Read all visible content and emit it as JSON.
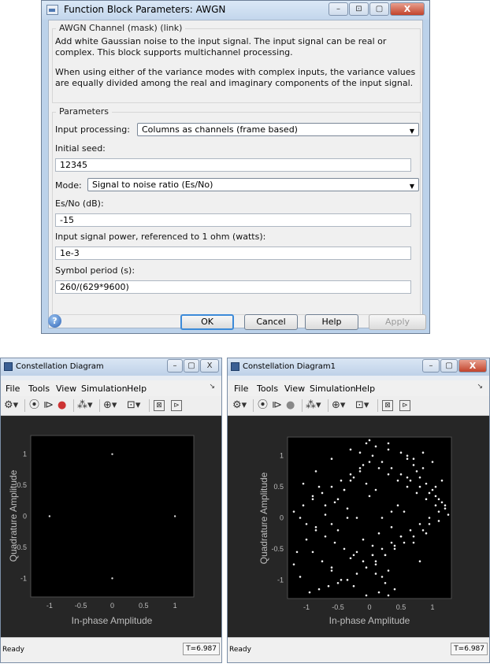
{
  "dialog": {
    "title": "Function Block Parameters: AWGN",
    "window_buttons": {
      "minimize": "–",
      "restore": "⊡",
      "maximize": "▢",
      "close": "X"
    },
    "mask_title": "AWGN Channel (mask) (link)",
    "description_1": "Add white Gaussian noise to the input signal. The input signal can be real or complex. This block supports multichannel processing.",
    "description_2": "When using either of the variance modes with complex inputs, the variance values are equally divided among the real and imaginary components of the input signal.",
    "parameters_title": "Parameters",
    "input_processing_label": "Input processing:",
    "input_processing_value": "Columns as channels (frame based)",
    "initial_seed_label": "Initial seed:",
    "initial_seed_value": "12345",
    "mode_label": "Mode:",
    "mode_value": "Signal to noise ratio  (Es/No)",
    "esno_label": "Es/No (dB):",
    "esno_value": "-15",
    "power_label": "Input signal power, referenced to 1 ohm (watts):",
    "power_value": "1e-3",
    "symbol_period_label": "Symbol period (s):",
    "symbol_period_value": "260/(629*9600)",
    "buttons": {
      "ok": "OK",
      "cancel": "Cancel",
      "help": "Help",
      "apply": "Apply"
    },
    "help_icon": "?"
  },
  "constellation_left": {
    "title": "Constellation Diagram",
    "menu": [
      "File",
      "Tools",
      "View",
      "Simulation",
      "Help"
    ],
    "status": "Ready",
    "time": "T=6.987",
    "ylabel": "Quadrature Amplitude",
    "xlabel": "In-phase Amplitude",
    "ticks": [
      "-1",
      "-0.5",
      "0",
      "0.5",
      "1"
    ]
  },
  "constellation_right": {
    "title": "Constellation Diagram1",
    "menu": [
      "File",
      "Tools",
      "View",
      "Simulation",
      "Help"
    ],
    "status": "Ready",
    "time": "T=6.987",
    "ylabel": "Quadrature Amplitude",
    "xlabel": "In-phase Amplitude",
    "ticks": [
      "-1",
      "-0.5",
      "0",
      "0.5",
      "1"
    ]
  },
  "chart_data": [
    {
      "type": "scatter",
      "title": "",
      "xlabel": "In-phase Amplitude",
      "ylabel": "Quadrature Amplitude",
      "xlim": [
        -1.3,
        1.3
      ],
      "ylim": [
        -1.3,
        1.3
      ],
      "x_ticks": [
        -1,
        -0.5,
        0,
        0.5,
        1
      ],
      "y_ticks": [
        -1,
        -0.5,
        0,
        0.5,
        1
      ],
      "grid": false,
      "series": [
        {
          "x": [
            0,
            -1,
            1,
            0
          ],
          "y": [
            1,
            0,
            0,
            -1
          ]
        }
      ]
    },
    {
      "type": "scatter",
      "title": "",
      "xlabel": "In-phase Amplitude",
      "ylabel": "Quadrature Amplitude",
      "xlim": [
        -1.3,
        1.3
      ],
      "ylim": [
        -1.3,
        1.3
      ],
      "x_ticks": [
        -1,
        -0.5,
        0,
        0.5,
        1
      ],
      "y_ticks": [
        -1,
        -0.5,
        0,
        0.5,
        1
      ],
      "grid": false,
      "series": [
        {
          "x": [
            -0.05,
            0.1,
            0.3,
            0.5,
            0.6,
            0.7,
            0.75,
            0.8,
            0.9,
            1.0,
            1.05,
            1.15,
            1.2,
            1.25,
            1.1,
            0.95,
            0.85,
            0.7,
            0.55,
            0.4,
            0.25,
            0.1,
            -0.05,
            -0.2,
            -0.35,
            -0.5,
            -0.65,
            -0.8,
            -0.95,
            -1.1,
            -1.2,
            -1.15,
            -1.0,
            -0.85,
            -0.7,
            -0.55,
            -0.4,
            -0.25,
            -0.1,
            0.05,
            0.2,
            0.35,
            0.5,
            0.65,
            0.8,
            0.95,
            1.1,
            1.2,
            1.1,
            0.95,
            0.8,
            0.65,
            0.5,
            0.35,
            0.2,
            0.05,
            -0.1,
            -0.25,
            -0.4,
            -0.55,
            -0.7,
            -0.85,
            -1.0,
            -1.1,
            -1.2,
            -1.05,
            -0.9,
            -0.75,
            -0.6,
            -0.45,
            -0.3,
            -0.15,
            0.0,
            0.15,
            0.3,
            0.45,
            0.6,
            0.75,
            0.9,
            1.05,
            0.2,
            0.35,
            0.5,
            0.4,
            0.25,
            0.1,
            -0.2,
            -0.35,
            -0.5,
            -0.4,
            -0.3,
            -0.15,
            0.1,
            0.25,
            0.4,
            0.3,
            0.15,
            -0.05,
            -0.25,
            -0.45,
            -0.6,
            -0.75,
            -0.9,
            0.7,
            0.85,
            1.0,
            1.15,
            -1.05,
            -0.85,
            -0.6,
            -0.3,
            0.0,
            0.3,
            0.6,
            0.85,
            1.05,
            -0.1,
            0.05,
            0.15,
            -0.2,
            0.45,
            0.55,
            -0.5,
            -0.6,
            0.0,
            0.1,
            -0.05,
            0.2,
            0.3,
            -0.3,
            0.7,
            0.9,
            -0.7,
            -0.9,
            0.35,
            -0.35,
            0.6,
            -0.6,
            0.8,
            -0.8,
            0.05,
            -0.15
          ],
          "y": [
            1.2,
            1.15,
            1.1,
            1.05,
            0.95,
            0.85,
            0.75,
            0.65,
            0.55,
            0.45,
            0.35,
            0.25,
            0.15,
            0.05,
            -0.05,
            -0.1,
            -0.2,
            -0.3,
            -0.4,
            -0.5,
            -0.6,
            -0.7,
            -0.8,
            -0.9,
            -1.0,
            -1.05,
            -1.1,
            -1.15,
            -1.2,
            -0.95,
            -0.75,
            -0.55,
            -0.35,
            -0.15,
            0.05,
            0.25,
            0.45,
            0.65,
            0.85,
            1.0,
            0.9,
            0.8,
            0.7,
            0.6,
            0.5,
            0.4,
            0.3,
            0.2,
            0.1,
            0.0,
            -0.1,
            -0.2,
            -0.3,
            -0.4,
            -0.5,
            -0.6,
            -0.7,
            -0.6,
            -0.5,
            -0.4,
            -0.3,
            -0.2,
            -0.1,
            0.0,
            0.1,
            0.2,
            0.3,
            0.4,
            0.5,
            0.6,
            0.7,
            0.8,
            0.9,
            0.8,
            0.7,
            0.6,
            0.5,
            0.4,
            0.3,
            0.2,
            0.0,
            -0.15,
            -0.3,
            -0.45,
            -0.6,
            -0.75,
            0.0,
            0.15,
            0.3,
            0.45,
            0.6,
            0.75,
            -0.9,
            -1.05,
            -1.15,
            -1.25,
            -1.2,
            -1.25,
            -1.1,
            -1.0,
            -0.85,
            -0.7,
            -0.55,
            0.95,
            1.05,
            0.9,
            0.6,
            0.55,
            0.75,
            0.95,
            1.1,
            1.25,
            1.2,
            1.0,
            0.8,
            0.5,
            -0.35,
            -0.45,
            -0.25,
            -0.55,
            0.2,
            0.1,
            -0.2,
            -0.1,
            0.35,
            0.45,
            0.55,
            -0.95,
            -0.85,
            -0.65,
            -0.4,
            -0.25,
            0.2,
            0.35,
            0.1,
            0.0,
            0.65,
            -0.8,
            -0.7,
            0.5,
            -0.6,
            1.05
          ]
        }
      ]
    }
  ]
}
